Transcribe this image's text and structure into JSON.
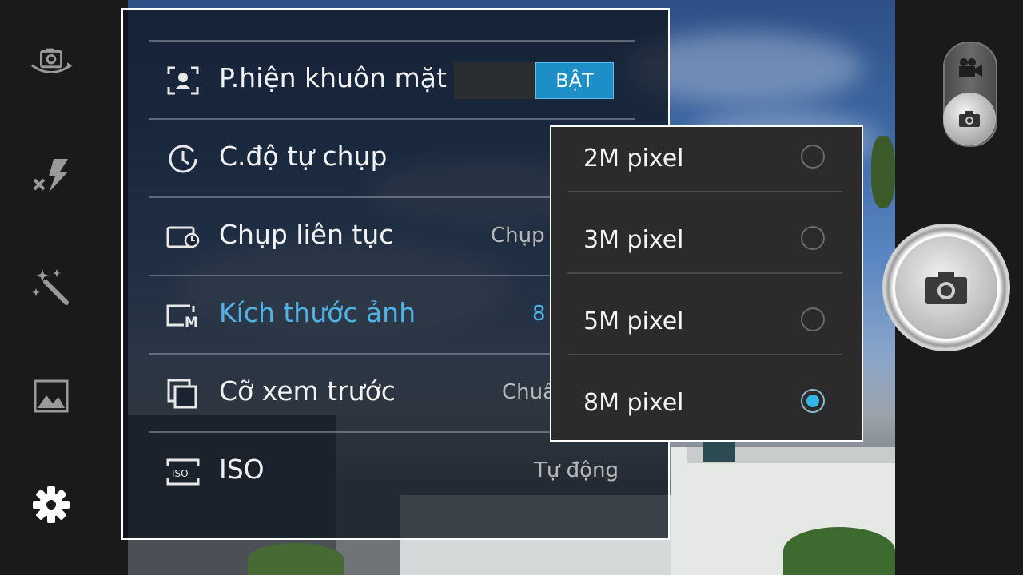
{
  "settings": {
    "rows": [
      {
        "label": "P.hiện khuôn mặt",
        "icon": "face-detect-icon",
        "toggle": "BẬT"
      },
      {
        "label": "C.độ tự chụp",
        "icon": "timer-icon"
      },
      {
        "label": "Chụp liên tục",
        "icon": "burst-icon",
        "value": "Chụp"
      },
      {
        "label": "Kích thước ảnh",
        "icon": "picture-size-icon",
        "value": "8"
      },
      {
        "label": "Cỡ xem trước",
        "icon": "preview-size-icon",
        "value": "Chuẩ"
      },
      {
        "label": "ISO",
        "icon": "iso-icon",
        "value": "Tự động"
      }
    ]
  },
  "size_popup": {
    "options": [
      {
        "label": "2M pixel",
        "selected": false
      },
      {
        "label": "3M pixel",
        "selected": false
      },
      {
        "label": "5M pixel",
        "selected": false
      },
      {
        "label": "8M pixel",
        "selected": true
      }
    ]
  },
  "left_toolbar": [
    "switch-camera-icon",
    "flash-off-icon",
    "effects-wand-icon",
    "gallery-icon",
    "settings-gear-icon"
  ],
  "right_toolbar": [
    "video-mode-icon",
    "photo-mode-icon",
    "shutter-button"
  ],
  "colors": {
    "accent": "#33b5e5",
    "toggle_on": "#1e8fc6",
    "active_label": "#4fb3e6"
  }
}
